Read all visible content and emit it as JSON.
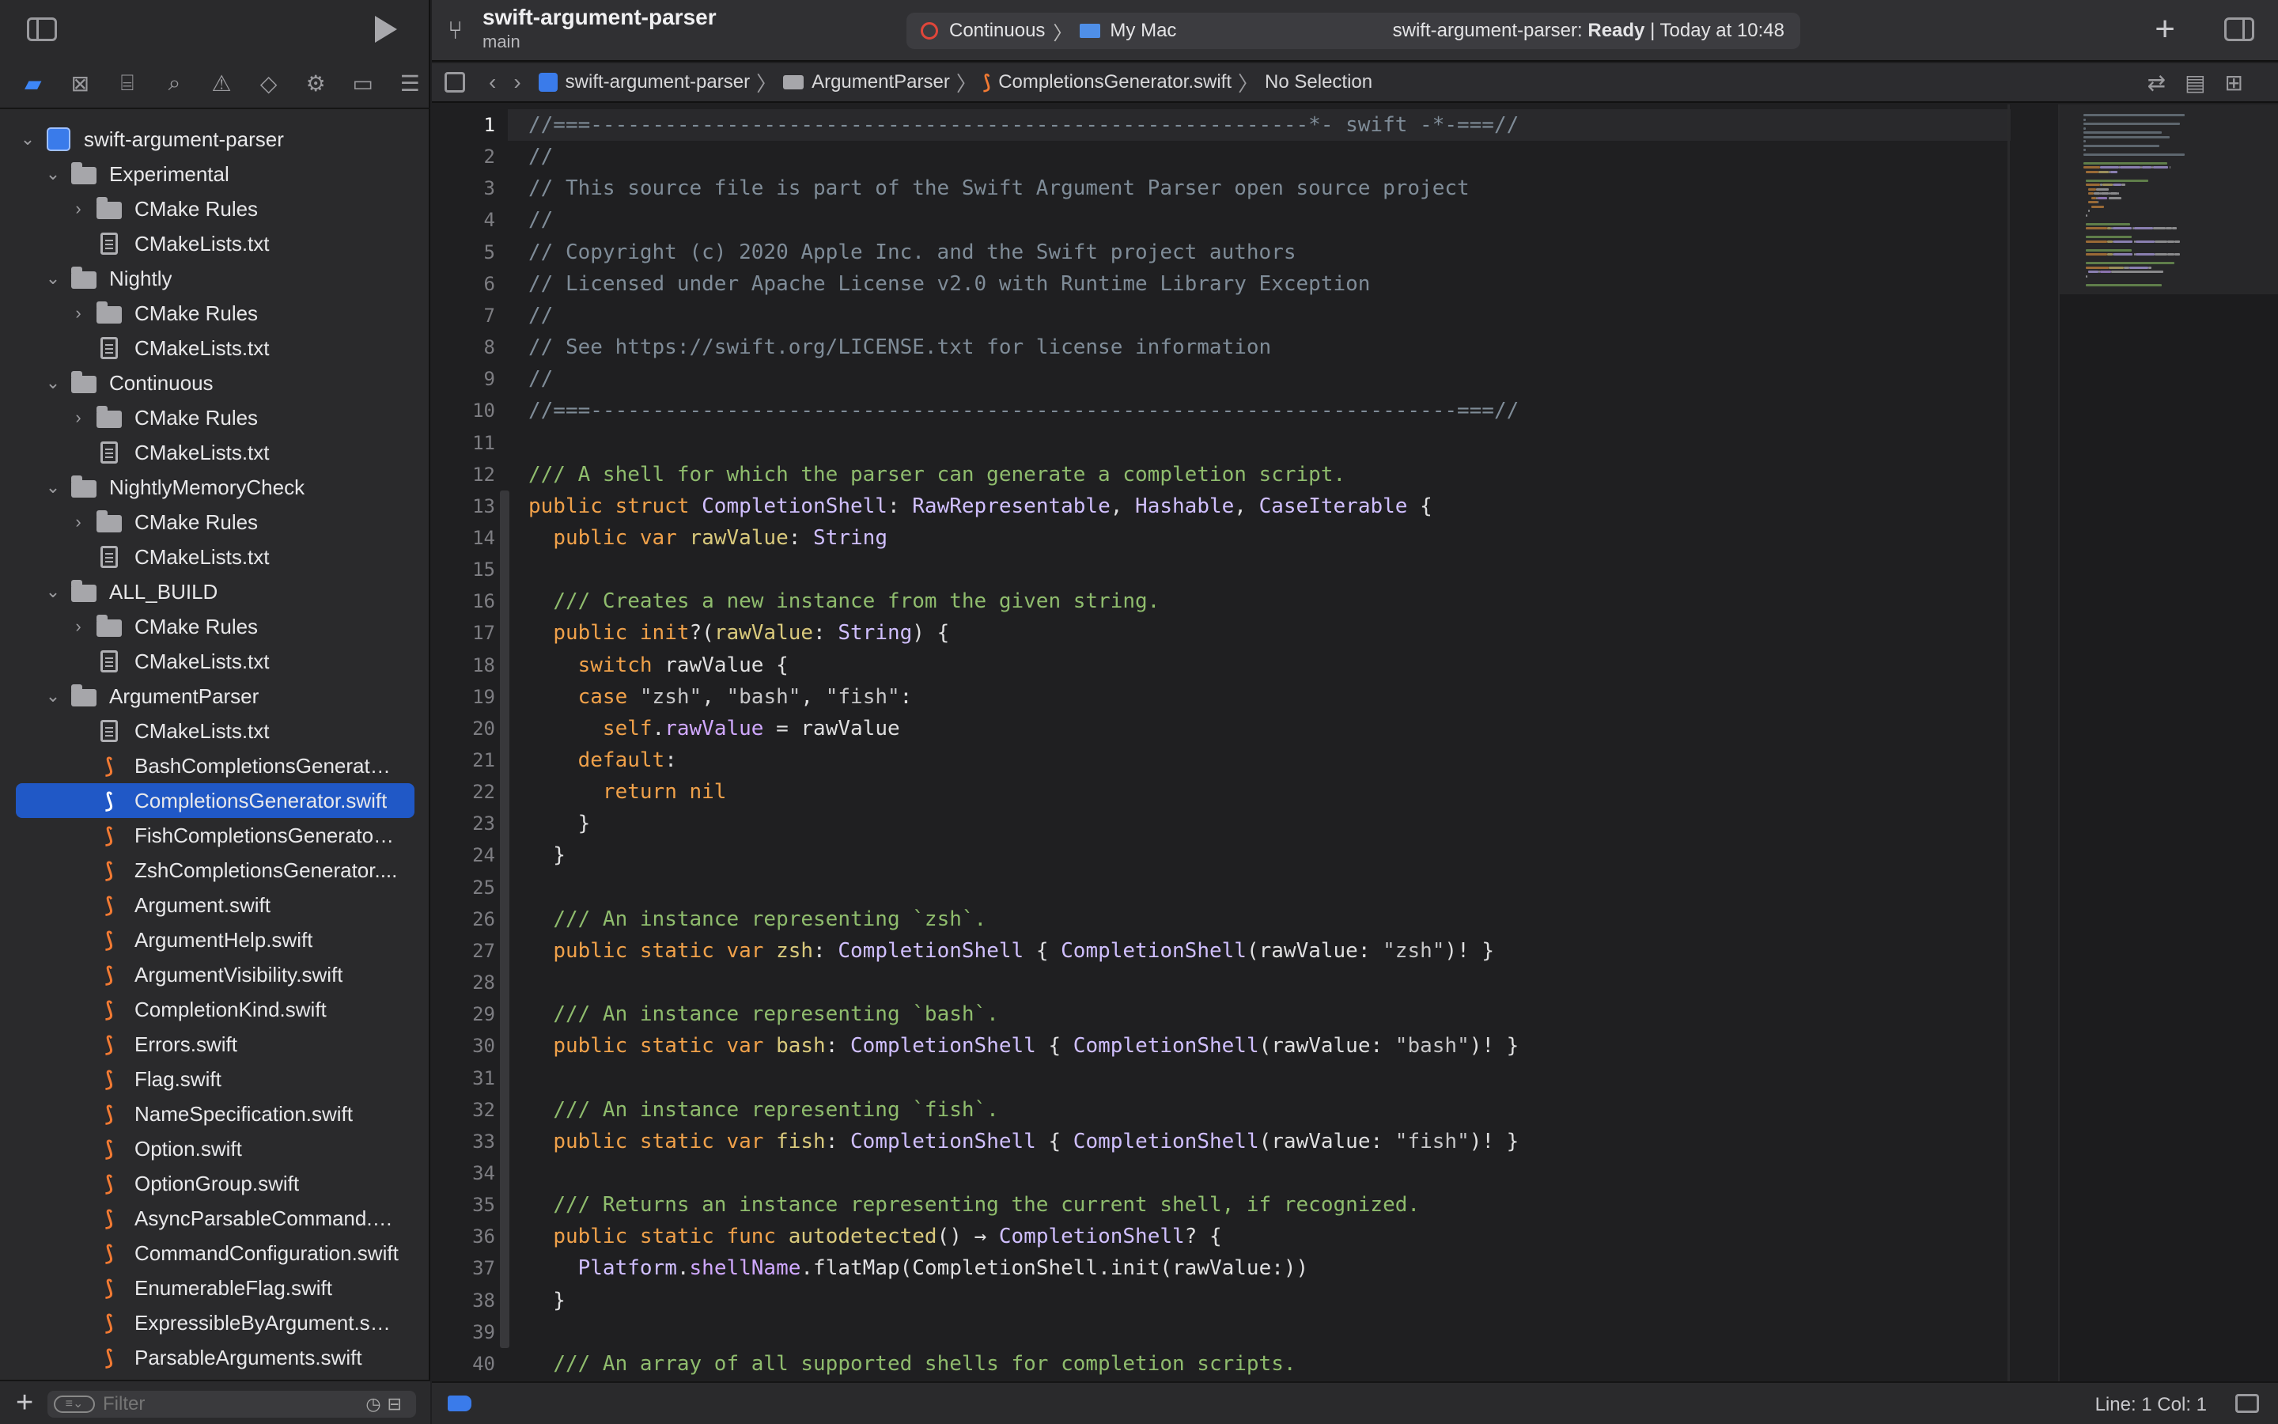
{
  "sidebar": {
    "nav_icons": [
      "folder-icon",
      "source-control-icon",
      "symbol-icon",
      "find-icon",
      "issue-icon",
      "test-icon",
      "debug-icon",
      "breakpoint-icon",
      "report-icon"
    ],
    "tree": [
      {
        "level": 0,
        "kind": "project",
        "label": "swift-argument-parser",
        "expanded": true
      },
      {
        "level": 1,
        "kind": "folder",
        "label": "Experimental",
        "expanded": true
      },
      {
        "level": 2,
        "kind": "folder",
        "label": "CMake Rules",
        "expanded": false
      },
      {
        "level": 2,
        "kind": "file",
        "label": "CMakeLists.txt"
      },
      {
        "level": 1,
        "kind": "folder",
        "label": "Nightly",
        "expanded": true
      },
      {
        "level": 2,
        "kind": "folder",
        "label": "CMake Rules",
        "expanded": false
      },
      {
        "level": 2,
        "kind": "file",
        "label": "CMakeLists.txt"
      },
      {
        "level": 1,
        "kind": "folder",
        "label": "Continuous",
        "expanded": true
      },
      {
        "level": 2,
        "kind": "folder",
        "label": "CMake Rules",
        "expanded": false
      },
      {
        "level": 2,
        "kind": "file",
        "label": "CMakeLists.txt"
      },
      {
        "level": 1,
        "kind": "folder",
        "label": "NightlyMemoryCheck",
        "expanded": true
      },
      {
        "level": 2,
        "kind": "folder",
        "label": "CMake Rules",
        "expanded": false
      },
      {
        "level": 2,
        "kind": "file",
        "label": "CMakeLists.txt"
      },
      {
        "level": 1,
        "kind": "folder",
        "label": "ALL_BUILD",
        "expanded": true
      },
      {
        "level": 2,
        "kind": "folder",
        "label": "CMake Rules",
        "expanded": false
      },
      {
        "level": 2,
        "kind": "file",
        "label": "CMakeLists.txt"
      },
      {
        "level": 1,
        "kind": "folder",
        "label": "ArgumentParser",
        "expanded": true
      },
      {
        "level": 2,
        "kind": "file",
        "label": "CMakeLists.txt"
      },
      {
        "level": 2,
        "kind": "swift",
        "label": "BashCompletionsGenerator..."
      },
      {
        "level": 2,
        "kind": "swift",
        "label": "CompletionsGenerator.swift",
        "selected": true
      },
      {
        "level": 2,
        "kind": "swift",
        "label": "FishCompletionsGenerator...."
      },
      {
        "level": 2,
        "kind": "swift",
        "label": "ZshCompletionsGenerator...."
      },
      {
        "level": 2,
        "kind": "swift",
        "label": "Argument.swift"
      },
      {
        "level": 2,
        "kind": "swift",
        "label": "ArgumentHelp.swift"
      },
      {
        "level": 2,
        "kind": "swift",
        "label": "ArgumentVisibility.swift"
      },
      {
        "level": 2,
        "kind": "swift",
        "label": "CompletionKind.swift"
      },
      {
        "level": 2,
        "kind": "swift",
        "label": "Errors.swift"
      },
      {
        "level": 2,
        "kind": "swift",
        "label": "Flag.swift"
      },
      {
        "level": 2,
        "kind": "swift",
        "label": "NameSpecification.swift"
      },
      {
        "level": 2,
        "kind": "swift",
        "label": "Option.swift"
      },
      {
        "level": 2,
        "kind": "swift",
        "label": "OptionGroup.swift"
      },
      {
        "level": 2,
        "kind": "swift",
        "label": "AsyncParsableCommand.s..."
      },
      {
        "level": 2,
        "kind": "swift",
        "label": "CommandConfiguration.swift"
      },
      {
        "level": 2,
        "kind": "swift",
        "label": "EnumerableFlag.swift"
      },
      {
        "level": 2,
        "kind": "swift",
        "label": "ExpressibleByArgument.swift"
      },
      {
        "level": 2,
        "kind": "swift",
        "label": "ParsableArguments.swift"
      }
    ],
    "filter_placeholder": "Filter"
  },
  "toolbar": {
    "project_name": "swift-argument-parser",
    "branch": "main",
    "scheme": "Continuous",
    "destination": "My Mac",
    "status_project": "swift-argument-parser:",
    "status_state": "Ready",
    "status_sep": "|",
    "status_time": "Today at 10:48"
  },
  "jumpbar": {
    "crumbs": [
      "swift-argument-parser",
      "ArgumentParser",
      "CompletionsGenerator.swift",
      "No Selection"
    ]
  },
  "editor": {
    "current_line": 1,
    "lines": [
      [
        [
          "c",
          "//===----------------------------------------------------------*- swift -*-===//"
        ]
      ],
      [
        [
          "c",
          "//"
        ]
      ],
      [
        [
          "c",
          "// This source file is part of the Swift Argument Parser open source project"
        ]
      ],
      [
        [
          "c",
          "//"
        ]
      ],
      [
        [
          "c",
          "// Copyright (c) 2020 Apple Inc. and the Swift project authors"
        ]
      ],
      [
        [
          "c",
          "// Licensed under Apache License v2.0 with Runtime Library Exception"
        ]
      ],
      [
        [
          "c",
          "//"
        ]
      ],
      [
        [
          "c",
          "// See https://swift.org/LICENSE.txt for license information"
        ]
      ],
      [
        [
          "c",
          "//"
        ]
      ],
      [
        [
          "c",
          "//===----------------------------------------------------------------------===//"
        ]
      ],
      [],
      [
        [
          "d",
          "/// A shell for which the parser can generate a completion script."
        ]
      ],
      [
        [
          "k2",
          "public struct "
        ],
        [
          "ty",
          "CompletionShell"
        ],
        [
          "p",
          ": "
        ],
        [
          "ty",
          "RawRepresentable"
        ],
        [
          "p",
          ", "
        ],
        [
          "ty",
          "Hashable"
        ],
        [
          "p",
          ", "
        ],
        [
          "ty",
          "CaseIterable"
        ],
        [
          "p",
          " {"
        ]
      ],
      [
        [
          "p",
          "  "
        ],
        [
          "k2",
          "public var "
        ],
        [
          "id",
          "rawValue"
        ],
        [
          "p",
          ": "
        ],
        [
          "ty",
          "String"
        ]
      ],
      [],
      [
        [
          "p",
          "  "
        ],
        [
          "d",
          "/// Creates a new instance from the given string."
        ]
      ],
      [
        [
          "p",
          "  "
        ],
        [
          "k2",
          "public init"
        ],
        [
          "p",
          "?("
        ],
        [
          "id",
          "rawValue"
        ],
        [
          "p",
          ": "
        ],
        [
          "ty",
          "String"
        ],
        [
          "p",
          ") {"
        ]
      ],
      [
        [
          "p",
          "    "
        ],
        [
          "k2",
          "switch "
        ],
        [
          "p",
          "rawValue {"
        ]
      ],
      [
        [
          "p",
          "    "
        ],
        [
          "k2",
          "case "
        ],
        [
          "str",
          "\"zsh\""
        ],
        [
          "p",
          ", "
        ],
        [
          "str",
          "\"bash\""
        ],
        [
          "p",
          ", "
        ],
        [
          "str",
          "\"fish\""
        ],
        [
          "p",
          ":"
        ]
      ],
      [
        [
          "p",
          "      "
        ],
        [
          "k2",
          "self"
        ],
        [
          "p",
          "."
        ],
        [
          "sl",
          "rawValue"
        ],
        [
          "p",
          " = rawValue"
        ]
      ],
      [
        [
          "p",
          "    "
        ],
        [
          "k2",
          "default"
        ],
        [
          "p",
          ":"
        ]
      ],
      [
        [
          "p",
          "      "
        ],
        [
          "k2",
          "return nil"
        ]
      ],
      [
        [
          "p",
          "    }"
        ]
      ],
      [
        [
          "p",
          "  }"
        ]
      ],
      [],
      [
        [
          "p",
          "  "
        ],
        [
          "d",
          "/// An instance representing `zsh`."
        ]
      ],
      [
        [
          "p",
          "  "
        ],
        [
          "k2",
          "public static var "
        ],
        [
          "id",
          "zsh"
        ],
        [
          "p",
          ": "
        ],
        [
          "ty",
          "CompletionShell"
        ],
        [
          "p",
          " { "
        ],
        [
          "ty",
          "CompletionShell"
        ],
        [
          "p",
          "(rawValue: "
        ],
        [
          "str",
          "\"zsh\""
        ],
        [
          "p",
          ")! }"
        ]
      ],
      [],
      [
        [
          "p",
          "  "
        ],
        [
          "d",
          "/// An instance representing `bash`."
        ]
      ],
      [
        [
          "p",
          "  "
        ],
        [
          "k2",
          "public static var "
        ],
        [
          "id",
          "bash"
        ],
        [
          "p",
          ": "
        ],
        [
          "ty",
          "CompletionShell"
        ],
        [
          "p",
          " { "
        ],
        [
          "ty",
          "CompletionShell"
        ],
        [
          "p",
          "(rawValue: "
        ],
        [
          "str",
          "\"bash\""
        ],
        [
          "p",
          ")! }"
        ]
      ],
      [],
      [
        [
          "p",
          "  "
        ],
        [
          "d",
          "/// An instance representing `fish`."
        ]
      ],
      [
        [
          "p",
          "  "
        ],
        [
          "k2",
          "public static var "
        ],
        [
          "id",
          "fish"
        ],
        [
          "p",
          ": "
        ],
        [
          "ty",
          "CompletionShell"
        ],
        [
          "p",
          " { "
        ],
        [
          "ty",
          "CompletionShell"
        ],
        [
          "p",
          "(rawValue: "
        ],
        [
          "str",
          "\"fish\""
        ],
        [
          "p",
          ")! }"
        ]
      ],
      [],
      [
        [
          "p",
          "  "
        ],
        [
          "d",
          "/// Returns an instance representing the current shell, if recognized."
        ]
      ],
      [
        [
          "p",
          "  "
        ],
        [
          "k2",
          "public static func "
        ],
        [
          "id",
          "autodetected"
        ],
        [
          "p",
          "() → "
        ],
        [
          "ty",
          "CompletionShell"
        ],
        [
          "p",
          "? {"
        ]
      ],
      [
        [
          "p",
          "    "
        ],
        [
          "ty",
          "Platform"
        ],
        [
          "p",
          "."
        ],
        [
          "sl",
          "shellName"
        ],
        [
          "p",
          ".flatMap(CompletionShell.init(rawValue:))"
        ]
      ],
      [
        [
          "p",
          "  }"
        ]
      ],
      [],
      [
        [
          "p",
          "  "
        ],
        [
          "d",
          "/// An array of all supported shells for completion scripts."
        ]
      ]
    ]
  },
  "statusbar": {
    "position": "Line: 1  Col: 1"
  },
  "colors": {
    "accent": "#3d86f7",
    "selection": "#2058c6",
    "swift_icon": "#f27a33",
    "scheme_icon": "#e0463a"
  }
}
